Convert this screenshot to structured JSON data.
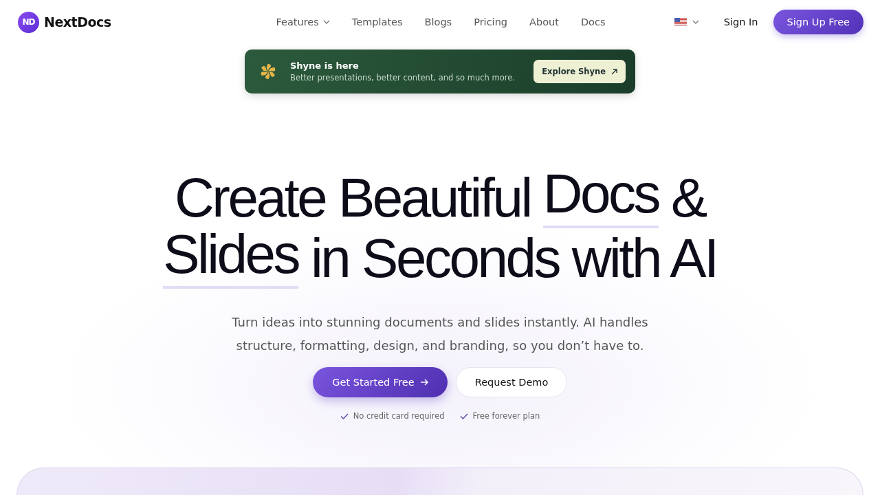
{
  "header": {
    "logo": {
      "mark": "ND",
      "name": "NextDocs"
    },
    "nav": [
      {
        "label": "Features",
        "dropdown": true
      },
      {
        "label": "Templates",
        "dropdown": false
      },
      {
        "label": "Blogs",
        "dropdown": false
      },
      {
        "label": "Pricing",
        "dropdown": false
      },
      {
        "label": "About",
        "dropdown": false
      },
      {
        "label": "Docs",
        "dropdown": false
      }
    ],
    "sign_in": "Sign In",
    "sign_up": "Sign Up Free"
  },
  "announcement": {
    "title": "Shyne is here",
    "text": "Better presentations, better content, and so much more.",
    "button": "Explore Shyne"
  },
  "hero": {
    "headline": [
      [
        {
          "text": "Create Beautiful",
          "highlight": false
        },
        {
          "text": "Docs",
          "highlight": true
        },
        {
          "text": "&",
          "highlight": false
        }
      ],
      [
        {
          "text": "Slides",
          "highlight": true
        },
        {
          "text": "in Seconds with AI",
          "highlight": false
        }
      ]
    ],
    "subtitle": "Turn ideas into stunning documents and slides instantly. AI handles structure, formatting, design, and branding, so you don’t have to.",
    "primary_button": "Get Started Free",
    "secondary_button": "Request Demo",
    "perks": [
      "No credit card required",
      "Free forever plan"
    ]
  }
}
